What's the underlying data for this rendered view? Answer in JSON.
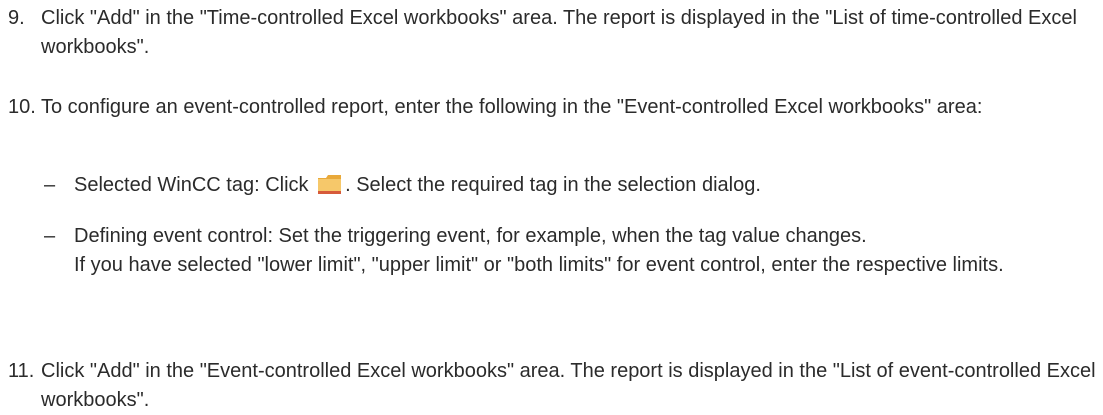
{
  "steps": [
    {
      "number": "9.",
      "text": "Click \"Add\" in the \"Time-controlled Excel workbooks\" area. The report is displayed in the \"List of time-controlled Excel workbooks\"."
    },
    {
      "number": "10.",
      "text": "To configure an event-controlled report, enter the following in the \"Event-controlled Excel workbooks\" area:",
      "subitems": [
        {
          "dash": "–",
          "before_icon": "Selected WinCC tag: Click",
          "icon": "folder-icon",
          "after_icon": ". Select the required tag in the selection dialog."
        },
        {
          "dash": "–",
          "text": "Defining event control: Set the triggering event, for example, when the tag value changes.",
          "text2": "If you have selected \"lower limit\", \"upper limit\" or \"both limits\" for event control, enter the respective limits."
        }
      ]
    },
    {
      "number": "11.",
      "text": "Click \"Add\" in the \"Event-controlled Excel workbooks\" area. The report is displayed in the \"List of event-controlled Excel workbooks\"."
    }
  ],
  "colors": {
    "text": "#2b2b2b",
    "folder_fill": "#f6c86a",
    "folder_tab": "#e9a93a",
    "folder_base": "#d65a3a"
  }
}
